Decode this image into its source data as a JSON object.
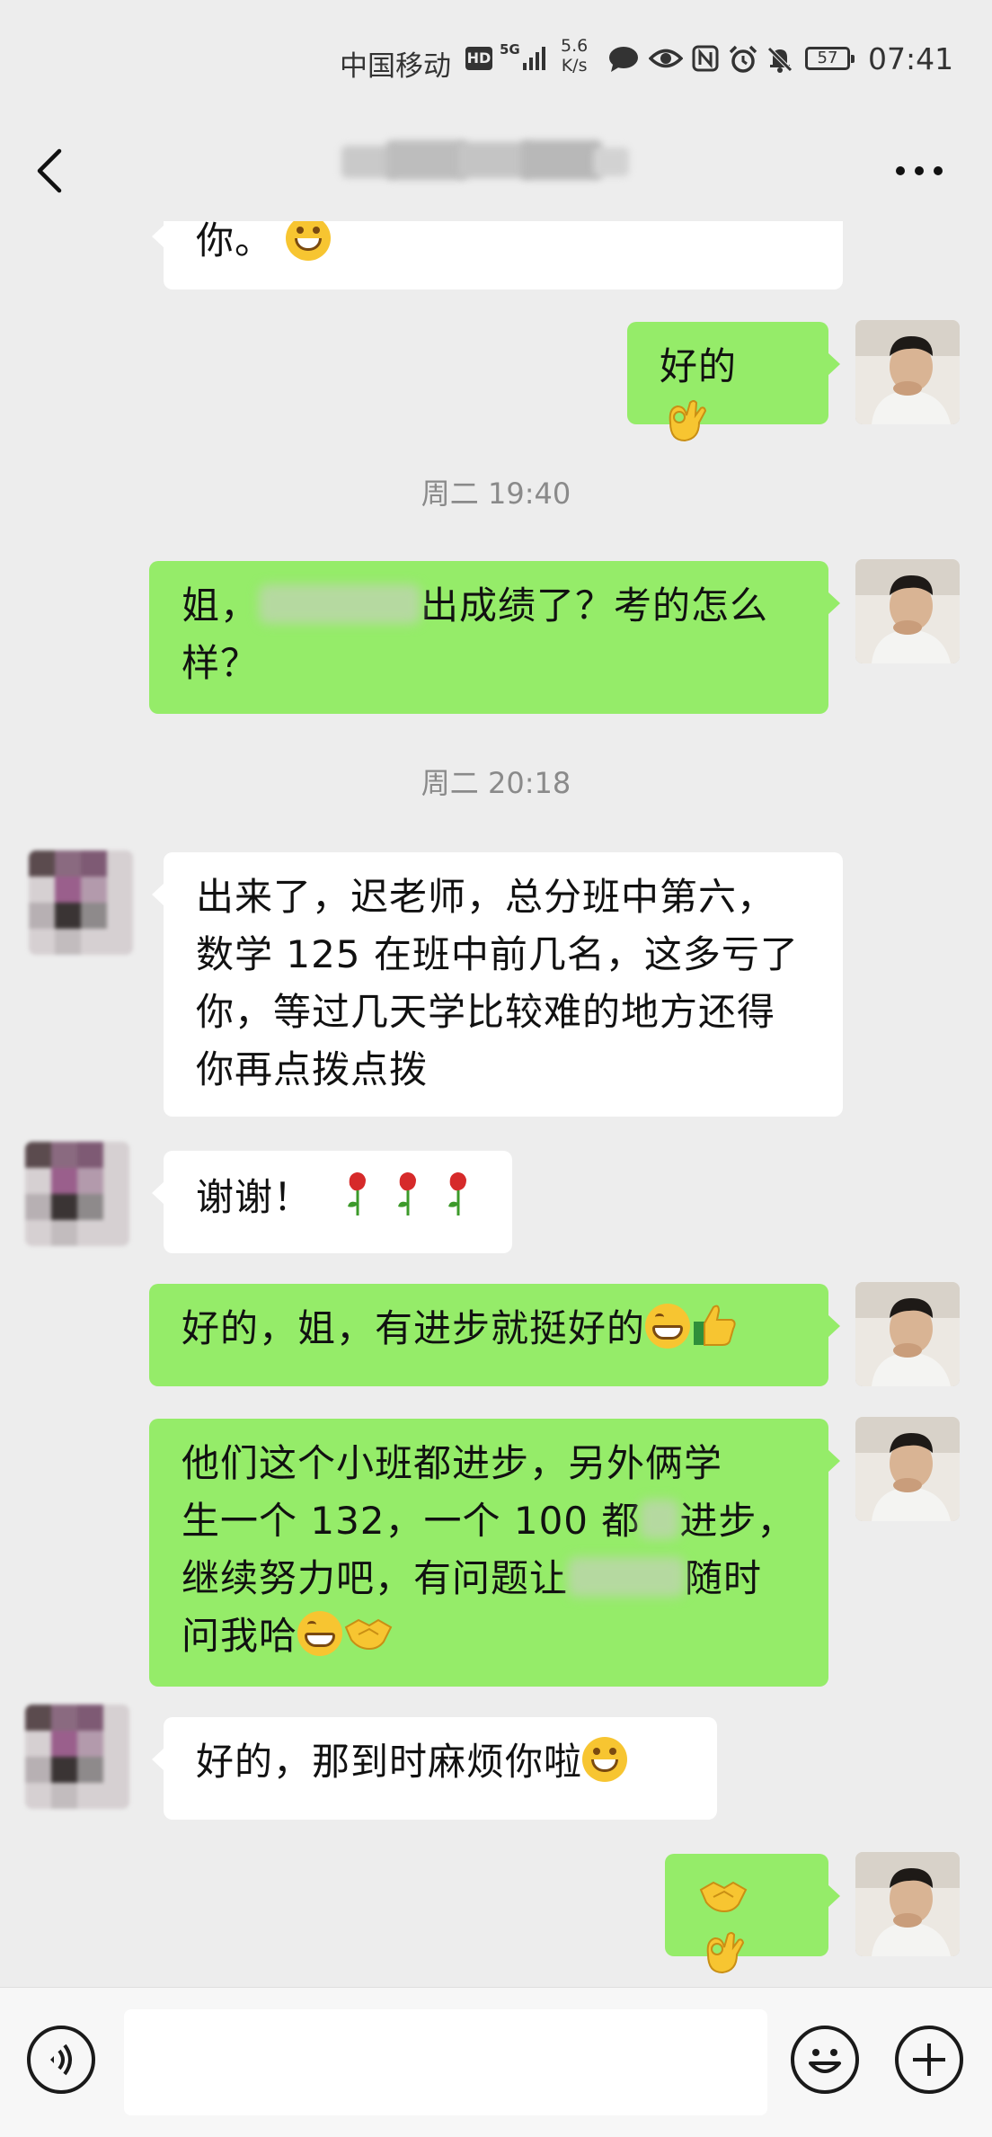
{
  "status_bar": {
    "carrier": "中国移动",
    "hd": "HD",
    "network": "5G",
    "speed_value": "5.6",
    "speed_unit": "K/s",
    "battery": "57",
    "time": "07:41"
  },
  "nav": {
    "title_obscured": true
  },
  "chat": {
    "timestamps": [
      "周二 19:40",
      "周二 20:18"
    ],
    "messages": [
      {
        "side": "left",
        "text": "你。",
        "emoji": "smile-emoji"
      },
      {
        "side": "right",
        "text": "好的",
        "emoji": "ok-hand-emoji"
      },
      {
        "side": "right",
        "text_before": "姐，",
        "text_after": "出成绩了？考的怎么样？",
        "contains_redaction": true
      },
      {
        "side": "left",
        "text": "出来了，迟老师，总分班中第六，数学 125 在班中前几名，这多亏了你，等过几天学比较难的地方还得你再点拨点拨"
      },
      {
        "side": "left",
        "text": "谢谢！",
        "emoji": "rose-emoji x3"
      },
      {
        "side": "right",
        "text": "好的，姐，有进步就挺好的",
        "emoji": "grin-emoji, thumbs-up-emoji"
      },
      {
        "side": "right",
        "text_line1": "他们这个小班都进步，另外俩学",
        "text_line2_a": "生一个 132，一个 100 都",
        "text_line2_b": "进步，",
        "text_line3_a": "继续努力吧，有问题让",
        "text_line3_b": "随时",
        "text_line4": "问我哈",
        "emoji": "grin-emoji, handshake-emoji",
        "contains_redaction": true
      },
      {
        "side": "left",
        "text": "好的，那到时麻烦你啦",
        "emoji": "smile-emoji"
      },
      {
        "side": "right",
        "text": "",
        "emoji": "handshake-emoji, ok-hand-emoji"
      }
    ]
  },
  "input_bar": {
    "placeholder": ""
  },
  "colors": {
    "background": "#ededed",
    "bubble_right": "#95ec69",
    "bubble_left": "#ffffff",
    "timestamp": "#8a8a8a"
  }
}
